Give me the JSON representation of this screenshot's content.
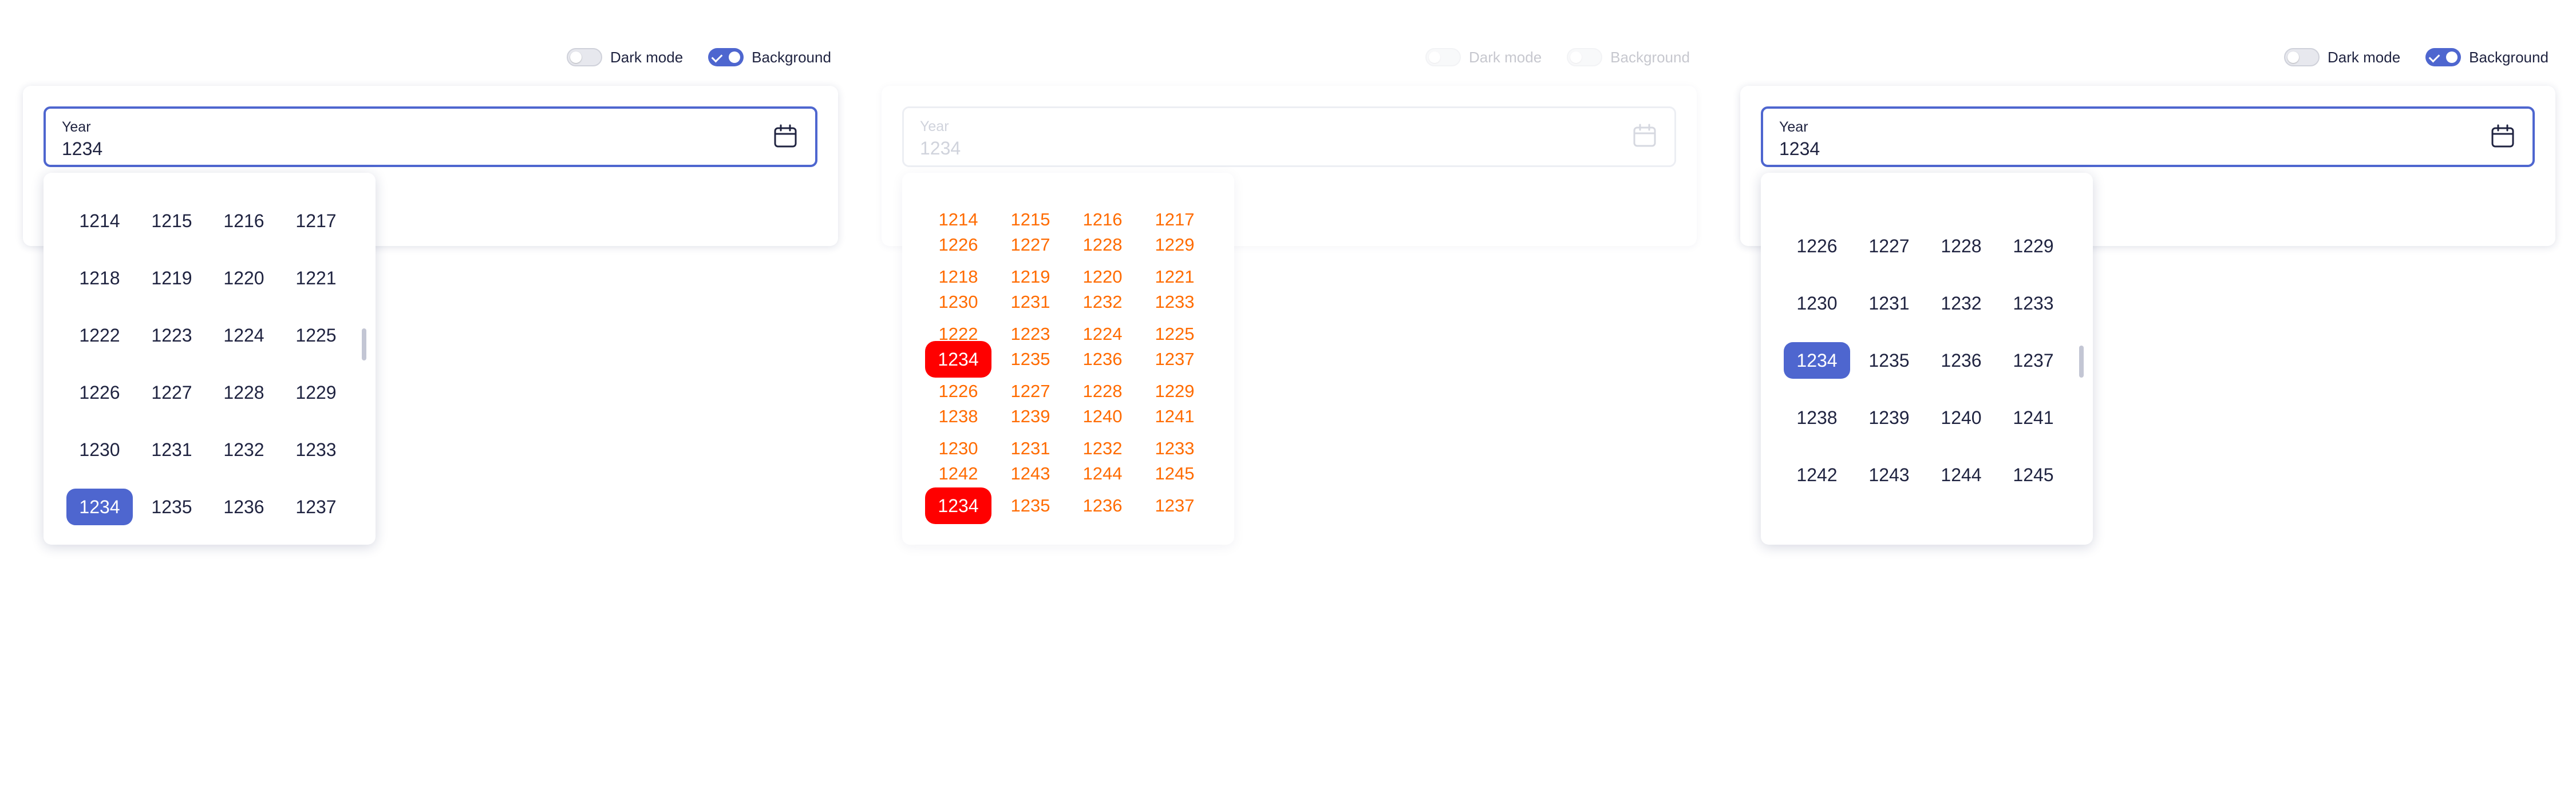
{
  "toggles": {
    "dark_mode": "Dark mode",
    "background": "Background"
  },
  "field": {
    "label": "Year",
    "value": "1234"
  },
  "accent_color": "#4e66cf",
  "panel1_rows": [
    [
      "1214",
      "1215",
      "1216",
      "1217"
    ],
    [
      "1218",
      "1219",
      "1220",
      "1221"
    ],
    [
      "1222",
      "1223",
      "1224",
      "1225"
    ],
    [
      "1226",
      "1227",
      "1228",
      "1229"
    ],
    [
      "1230",
      "1231",
      "1232",
      "1233"
    ],
    [
      "1234",
      "1235",
      "1236",
      "1237"
    ]
  ],
  "panel2_rows": [
    [
      "1214",
      "1215",
      "1216",
      "1217"
    ],
    [
      "1226",
      "1227",
      "1228",
      "1229"
    ],
    [
      "1218",
      "1219",
      "1220",
      "1221"
    ],
    [
      "1230",
      "1231",
      "1232",
      "1233"
    ],
    [
      "1222",
      "1223",
      "1224",
      "1225"
    ],
    [
      "1234",
      "1235",
      "1236",
      "1237"
    ],
    [
      "1226",
      "1227",
      "1228",
      "1229"
    ],
    [
      "1238",
      "1239",
      "1240",
      "1241"
    ],
    [
      "1230",
      "1231",
      "1232",
      "1233"
    ],
    [
      "1242",
      "1243",
      "1244",
      "1245"
    ],
    [
      "1234",
      "1235",
      "1236",
      "1237"
    ]
  ],
  "panel3_rows": [
    [
      "1226",
      "1227",
      "1228",
      "1229"
    ],
    [
      "1230",
      "1231",
      "1232",
      "1233"
    ],
    [
      "1234",
      "1235",
      "1236",
      "1237"
    ],
    [
      "1238",
      "1239",
      "1240",
      "1241"
    ],
    [
      "1242",
      "1243",
      "1244",
      "1245"
    ]
  ],
  "selected_year": "1234"
}
